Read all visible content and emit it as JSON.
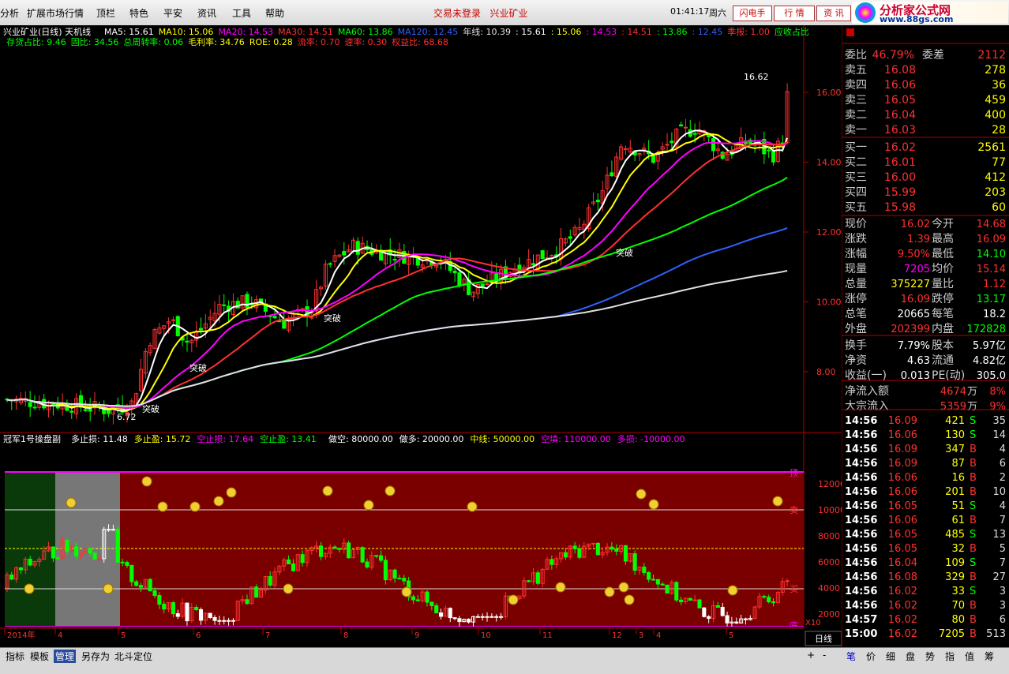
{
  "menu": {
    "items": [
      "分析",
      "扩展市场行情",
      "顶栏",
      "特色",
      "平安",
      "资讯",
      "工具",
      "帮助"
    ],
    "trade_notice": "交易未登录",
    "stock_name": "兴业矿业",
    "time": "01:41:17",
    "weekday": "周六",
    "btn_flash": "闪电手",
    "btn_quote": "行 情",
    "btn_info": "资 讯"
  },
  "logo": {
    "title": "分析家公式网",
    "url": "www.88gs.com"
  },
  "main_panel": {
    "title": "兴业矿业(日线) 天机线",
    "ma": [
      {
        "label": "MA5: 15.61",
        "color": "#ffffff"
      },
      {
        "label": "MA10: 15.06",
        "color": "#ffff00"
      },
      {
        "label": "MA20: 14.53",
        "color": "#ff00ff"
      },
      {
        "label": "MA30: 14.51",
        "color": "#ff3030"
      },
      {
        "label": "MA60: 13.86",
        "color": "#00ff00"
      },
      {
        "label": "MA120: 12.45",
        "color": "#3060ff"
      },
      {
        "label": "年线: 10.39",
        "color": "#e0e0e0"
      },
      {
        "label": ": 15.61",
        "color": "#ffffff"
      },
      {
        "label": ": 15.06",
        "color": "#ffff00"
      },
      {
        "label": ": 14.53",
        "color": "#ff00ff"
      },
      {
        "label": ": 14.51",
        "color": "#ff3030"
      },
      {
        "label": ": 13.86",
        "color": "#00ff00"
      },
      {
        "label": ": 12.45",
        "color": "#3060ff"
      },
      {
        "label": "季报: 1.00",
        "color": "#ff3030"
      },
      {
        "label": "应收占比",
        "color": "#00ff00"
      }
    ],
    "fin": [
      {
        "label": "存货占比: 9.46",
        "color": "#00ff00"
      },
      {
        "label": "固比: 34.56",
        "color": "#00ff00"
      },
      {
        "label": "总周转率: 0.06",
        "color": "#00ff00"
      },
      {
        "label": "毛利率: 34.76",
        "color": "#ffff00"
      },
      {
        "label": "ROE: 0.28",
        "color": "#ffff00"
      },
      {
        "label": "流率: 0.70",
        "color": "#ff3030"
      },
      {
        "label": "速率: 0.30",
        "color": "#ff3030"
      },
      {
        "label": "权益比: 68.68",
        "color": "#ff3030"
      }
    ],
    "price_ticks": [
      "16.00",
      "14.00",
      "12.00",
      "10.00",
      "8.00"
    ],
    "high_label": "16.62",
    "low_label": "6.72",
    "breakout_label": "突破"
  },
  "sub_panel": {
    "title": "冠军1号操盘副",
    "params": [
      {
        "label": "多止损: 11.48",
        "color": "#ffffff"
      },
      {
        "label": "多止盈: 15.72",
        "color": "#ffff00"
      },
      {
        "label": "空止损: 17.64",
        "color": "#ff00ff"
      },
      {
        "label": "空止盈: 13.41",
        "color": "#00ff00"
      },
      {
        "label": "做空: 80000.00",
        "color": "#ffffff"
      },
      {
        "label": "做多: 20000.00",
        "color": "#ffffff"
      },
      {
        "label": "中线: 50000.00",
        "color": "#ffff00"
      },
      {
        "label": "空填: 110000.00",
        "color": "#ff00ff"
      },
      {
        "label": "多损: -10000.00",
        "color": "#ff00ff"
      }
    ],
    "ticks": [
      "12000",
      "10000",
      "8000",
      "6000",
      "4000",
      "2000"
    ],
    "side": {
      "top": "顶",
      "sell": "卖",
      "buy": "买",
      "bottom": "底"
    },
    "scale": "X10"
  },
  "x_axis": {
    "labels": [
      "2014年",
      "4",
      "5",
      "6",
      "7",
      "8",
      "9",
      "10",
      "11",
      "12",
      "3",
      "4",
      "5"
    ],
    "period": "日线"
  },
  "order_book": {
    "wei_bi_label": "委比",
    "wei_bi": "46.79%",
    "wei_cha_label": "委差",
    "wei_cha": "2112",
    "sell": [
      {
        "name": "卖五",
        "price": "16.08",
        "vol": "278"
      },
      {
        "name": "卖四",
        "price": "16.06",
        "vol": "36"
      },
      {
        "name": "卖三",
        "price": "16.05",
        "vol": "459"
      },
      {
        "name": "卖二",
        "price": "16.04",
        "vol": "400"
      },
      {
        "name": "卖一",
        "price": "16.03",
        "vol": "28"
      }
    ],
    "buy": [
      {
        "name": "买一",
        "price": "16.02",
        "vol": "2561"
      },
      {
        "name": "买二",
        "price": "16.01",
        "vol": "77"
      },
      {
        "name": "买三",
        "price": "16.00",
        "vol": "412"
      },
      {
        "name": "买四",
        "price": "15.99",
        "vol": "203"
      },
      {
        "name": "买五",
        "price": "15.98",
        "vol": "60"
      }
    ]
  },
  "stats": [
    {
      "l1": "现价",
      "v1": "16.02",
      "c1": "#ff3030",
      "l2": "今开",
      "v2": "14.68",
      "c2": "#ff3030"
    },
    {
      "l1": "涨跌",
      "v1": "1.39",
      "c1": "#ff3030",
      "l2": "最高",
      "v2": "16.09",
      "c2": "#ff3030"
    },
    {
      "l1": "涨幅",
      "v1": "9.50%",
      "c1": "#ff3030",
      "l2": "最低",
      "v2": "14.10",
      "c2": "#00ff00"
    },
    {
      "l1": "现量",
      "v1": "7205",
      "c1": "#ff00ff",
      "l2": "均价",
      "v2": "15.14",
      "c2": "#ff3030"
    },
    {
      "l1": "总量",
      "v1": "375227",
      "c1": "#ffff00",
      "l2": "量比",
      "v2": "1.12",
      "c2": "#ff3030"
    },
    {
      "l1": "涨停",
      "v1": "16.09",
      "c1": "#ff3030",
      "l2": "跌停",
      "v2": "13.17",
      "c2": "#00ff00"
    },
    {
      "l1": "总笔",
      "v1": "20665",
      "c1": "#ffffff",
      "l2": "每笔",
      "v2": "18.2",
      "c2": "#ffffff"
    },
    {
      "l1": "外盘",
      "v1": "202399",
      "c1": "#ff3030",
      "l2": "内盘",
      "v2": "172828",
      "c2": "#00ff00"
    }
  ],
  "stats2": [
    {
      "l1": "换手",
      "v1": "7.79%",
      "l2": "股本",
      "v2": "5.97亿"
    },
    {
      "l1": "净资",
      "v1": "4.63",
      "l2": "流通",
      "v2": "4.82亿"
    },
    {
      "l1": "收益(一)",
      "v1": "0.013",
      "l2": "PE(动)",
      "v2": "305.0"
    }
  ],
  "flow": [
    {
      "label": "净流入额",
      "value": "4674",
      "unit": "万",
      "pct": "8%"
    },
    {
      "label": "大宗流入",
      "value": "5359",
      "unit": "万",
      "pct": "9%"
    }
  ],
  "ticks": [
    {
      "t": "14:56",
      "p": "16.09",
      "v": "421",
      "s": "S",
      "n": "35"
    },
    {
      "t": "14:56",
      "p": "16.06",
      "v": "130",
      "s": "S",
      "n": "14"
    },
    {
      "t": "14:56",
      "p": "16.09",
      "v": "347",
      "s": "B",
      "n": "4"
    },
    {
      "t": "14:56",
      "p": "16.09",
      "v": "87",
      "s": "B",
      "n": "6"
    },
    {
      "t": "14:56",
      "p": "16.06",
      "v": "16",
      "s": "B",
      "n": "2"
    },
    {
      "t": "14:56",
      "p": "16.06",
      "v": "201",
      "s": "B",
      "n": "10"
    },
    {
      "t": "14:56",
      "p": "16.05",
      "v": "51",
      "s": "S",
      "n": "4"
    },
    {
      "t": "14:56",
      "p": "16.06",
      "v": "61",
      "s": "B",
      "n": "7"
    },
    {
      "t": "14:56",
      "p": "16.05",
      "v": "485",
      "s": "S",
      "n": "13"
    },
    {
      "t": "14:56",
      "p": "16.05",
      "v": "32",
      "s": "B",
      "n": "5"
    },
    {
      "t": "14:56",
      "p": "16.04",
      "v": "109",
      "s": "S",
      "n": "7"
    },
    {
      "t": "14:56",
      "p": "16.08",
      "v": "329",
      "s": "B",
      "n": "27"
    },
    {
      "t": "14:56",
      "p": "16.02",
      "v": "33",
      "s": "S",
      "n": "3"
    },
    {
      "t": "14:56",
      "p": "16.02",
      "v": "70",
      "s": "B",
      "n": "3"
    },
    {
      "t": "14:57",
      "p": "16.02",
      "v": "80",
      "s": "B",
      "n": "6"
    },
    {
      "t": "15:00",
      "p": "16.02",
      "v": "7205",
      "s": "B",
      "n": "513"
    }
  ],
  "bottom": {
    "tabs": [
      "指标",
      "模板",
      "管理",
      "另存为",
      "北斗定位"
    ],
    "active": "管理",
    "right_tabs": [
      "笔",
      "价",
      "细",
      "盘",
      "势",
      "指",
      "值",
      "筹"
    ]
  },
  "colors": {
    "up": "#ff3030",
    "down": "#00ff00",
    "ma5": "#ffffff",
    "ma10": "#ffff00",
    "ma20": "#ff00ff",
    "ma30": "#ff3030",
    "ma60": "#00ff00",
    "ma120": "#3060ff",
    "year": "#e0e0e0"
  }
}
